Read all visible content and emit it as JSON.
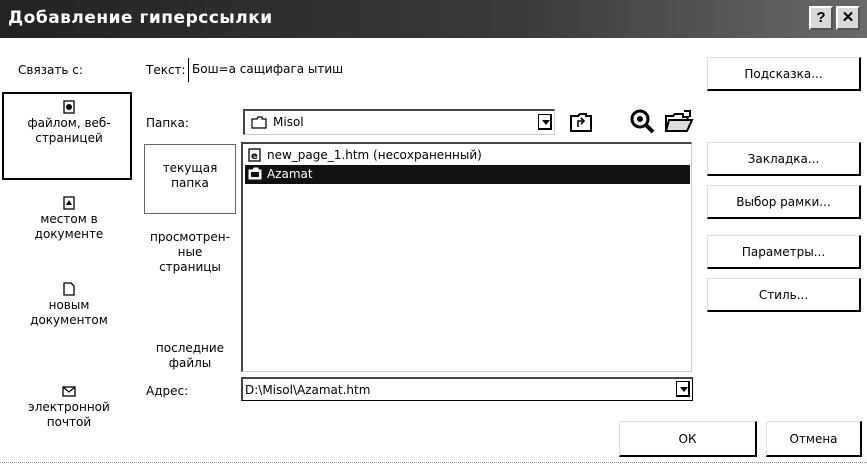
{
  "window": {
    "title": "Добавление гиперссылки",
    "help_label": "?",
    "close_label": "✕"
  },
  "link_with": {
    "label": "Связать с:",
    "items": [
      {
        "label": "файлом, веб-страницей",
        "line1": "файлом, веб-",
        "line2": "страницей",
        "icon": "web-page-icon"
      },
      {
        "label": "местом в документе",
        "line1": "местом в",
        "line2": "документе",
        "icon": "place-in-document-icon"
      },
      {
        "label": "новым документом",
        "line1": "новым",
        "line2": "документом",
        "icon": "new-document-icon"
      },
      {
        "label": "электронной почтой",
        "line1": "электронной",
        "line2": "почтой",
        "icon": "email-icon"
      }
    ]
  },
  "text_field": {
    "label": "Текст:",
    "value": "Бош=а сащифага ытиш"
  },
  "folder": {
    "label": "Папка:",
    "value": "Misol"
  },
  "lookin": {
    "items": [
      {
        "line1": "текущая",
        "line2": "папка",
        "line3": ""
      },
      {
        "line1": "просмотрен-",
        "line2": "ные",
        "line3": "страницы"
      },
      {
        "line1": "последние",
        "line2": "файлы",
        "line3": ""
      }
    ]
  },
  "files": [
    {
      "name": "new_page_1.htm (несохраненный)",
      "icon": "html-file-icon",
      "selected": false
    },
    {
      "name": "Azamat",
      "icon": "folder-icon",
      "selected": true
    }
  ],
  "address": {
    "label": "Адрес:",
    "value": "D:\\Misol\\Azamat.htm"
  },
  "buttons": {
    "hint": "Подсказка...",
    "bookmark": "Закладка...",
    "frame": "Выбор рамки...",
    "params": "Параметры...",
    "style": "Стиль...",
    "ok": "ОК",
    "cancel": "Отмена"
  },
  "colors": {
    "titlebar": "#2a2a2a",
    "selection": "#111111"
  }
}
